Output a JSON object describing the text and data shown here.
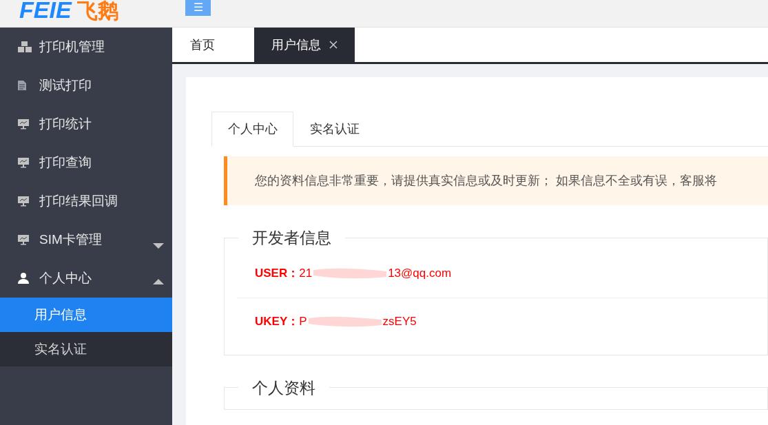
{
  "logo": {
    "latin": "FEIE",
    "chinese": "飞鹅"
  },
  "menu_button": {
    "label": "☰"
  },
  "sidebar": {
    "items": [
      {
        "label": "打印机管理",
        "kind": "cubes"
      },
      {
        "label": "测试打印",
        "kind": "document"
      },
      {
        "label": "打印统计",
        "kind": "monitor"
      },
      {
        "label": "打印查询",
        "kind": "monitor"
      },
      {
        "label": "打印结果回调",
        "kind": "monitor"
      },
      {
        "label": "SIM卡管理",
        "kind": "monitor",
        "expanded": false
      },
      {
        "label": "个人中心",
        "kind": "user",
        "expanded": true,
        "children": [
          {
            "label": "用户信息",
            "selected": true
          },
          {
            "label": "实名认证",
            "selected": false
          }
        ]
      }
    ]
  },
  "page_tabs": [
    {
      "label": "首页",
      "selected": false,
      "closable": false
    },
    {
      "label": "用户信息",
      "selected": true,
      "closable": true
    }
  ],
  "content_tabs": [
    {
      "label": "个人中心",
      "selected": true
    },
    {
      "label": "实名认证",
      "selected": false
    }
  ],
  "notice": "您的资料信息非常重要，请提供真实信息或及时更新； 如果信息不全或有误，客服将",
  "sections": [
    {
      "title": "开发者信息",
      "fields": [
        {
          "label": "USER：",
          "value_start": "21",
          "value_end": "13@qq.com"
        },
        {
          "label": "UKEY：",
          "value_start": "P",
          "value_end": "zsEY5"
        }
      ]
    },
    {
      "title": "个人资料"
    }
  ]
}
